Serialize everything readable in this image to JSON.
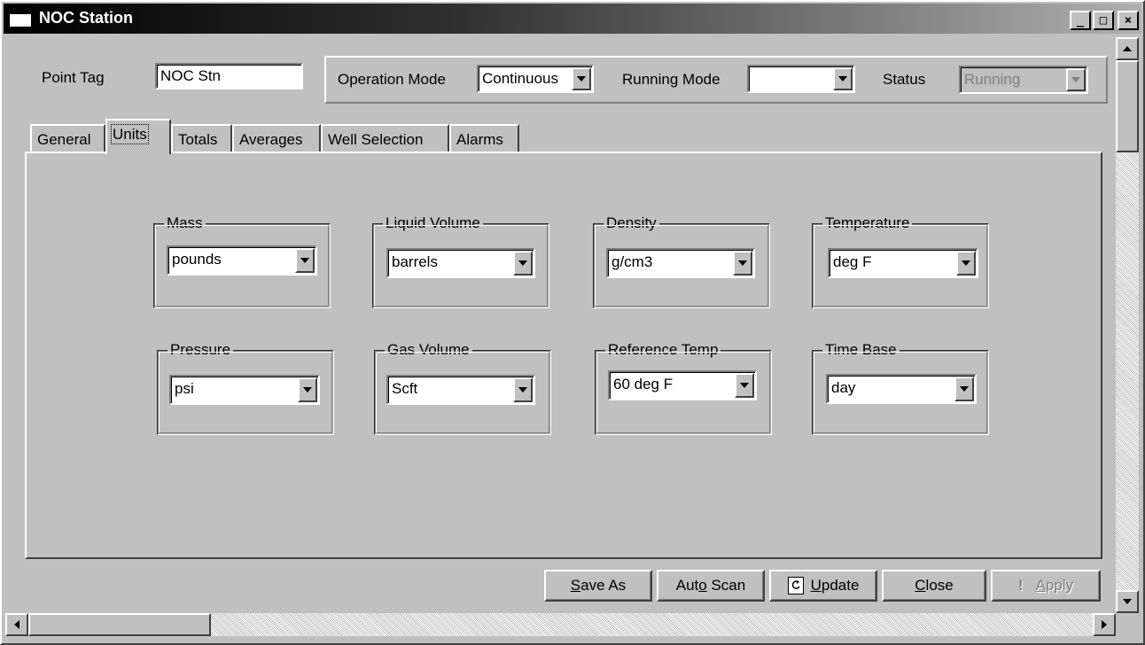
{
  "window": {
    "title": "NOC Station"
  },
  "header": {
    "point_tag_label": "Point Tag",
    "point_tag_value": "NOC Stn",
    "operation_mode_label": "Operation Mode",
    "operation_mode_value": "Continuous",
    "running_mode_label": "Running Mode",
    "running_mode_value": "",
    "status_label": "Status",
    "status_value": "Running"
  },
  "tabs": [
    {
      "label": "General"
    },
    {
      "label": "Units",
      "active": true
    },
    {
      "label": "Totals"
    },
    {
      "label": "Averages"
    },
    {
      "label": "Well Selection"
    },
    {
      "label": "Alarms"
    }
  ],
  "units": {
    "mass": {
      "label": "Mass",
      "value": "pounds"
    },
    "liquid_volume": {
      "label": "Liquid Volume",
      "value": "barrels"
    },
    "density": {
      "label": "Density",
      "value": "g/cm3"
    },
    "temperature": {
      "label": "Temperature",
      "value": "deg F"
    },
    "pressure": {
      "label": "Pressure",
      "value": "psi"
    },
    "gas_volume": {
      "label": "Gas Volume",
      "value": "Scft"
    },
    "reference_temp": {
      "label": "Reference Temp",
      "value": "60 deg F"
    },
    "time_base": {
      "label": "Time Base",
      "value": "day"
    }
  },
  "buttons": {
    "save_as": {
      "mnemonic": "S",
      "rest": "ave As"
    },
    "auto_scan": {
      "pre": "Aut",
      "mnemonic": "o",
      "rest": " Scan"
    },
    "update": {
      "mnemonic": "U",
      "rest": "pdate"
    },
    "close": {
      "mnemonic": "C",
      "rest": "lose"
    },
    "apply": {
      "mnemonic": "A",
      "rest": "pply"
    }
  },
  "icons": {
    "update": "refresh-icon",
    "apply": "exclamation-icon",
    "window": "window-icon"
  },
  "caption_buttons": {
    "minimize": "_",
    "maximize": "□",
    "close": "×"
  }
}
